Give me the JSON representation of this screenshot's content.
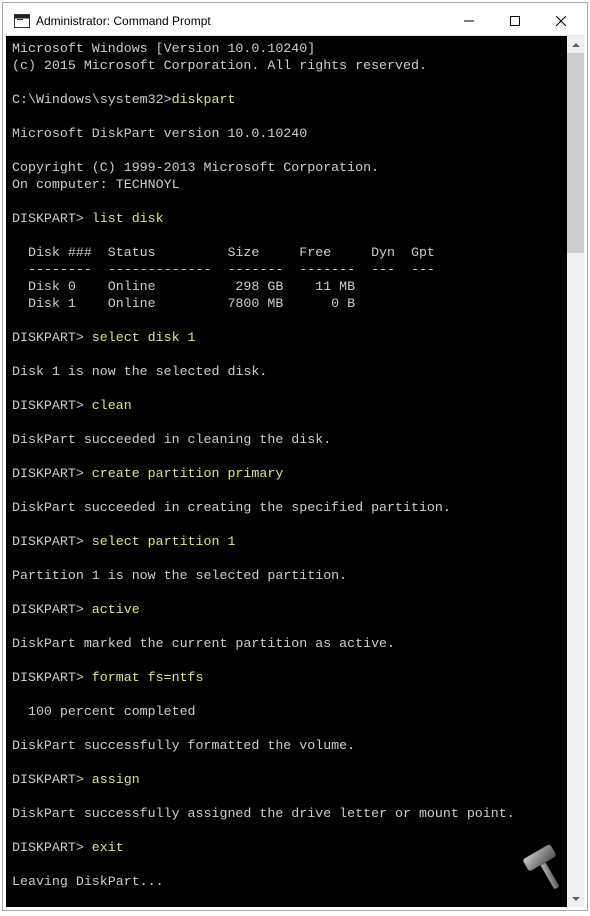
{
  "titlebar": {
    "title": "Administrator: Command Prompt"
  },
  "prompts": {
    "cmd_prompt": "C:\\Windows\\system32>",
    "diskpart_prompt": "DISKPART> "
  },
  "commands": {
    "diskpart": "diskpart",
    "list_disk": "list disk",
    "select_disk1": "select disk 1",
    "clean": "clean",
    "create_partition": "create partition primary",
    "select_partition1": "select partition 1",
    "active": "active",
    "format": "format fs=ntfs",
    "assign": "assign",
    "exit": "exit"
  },
  "output": {
    "header1": "Microsoft Windows [Version 10.0.10240]",
    "header2": "(c) 2015 Microsoft Corporation. All rights reserved.",
    "blank": "",
    "dp_version": "Microsoft DiskPart version 10.0.10240",
    "dp_copyright": "Copyright (C) 1999-2013 Microsoft Corporation.",
    "dp_computer": "On computer: TECHNOYL",
    "disk_header": "  Disk ###  Status         Size     Free     Dyn  Gpt",
    "disk_sep": "  --------  -------------  -------  -------  ---  ---",
    "disk0": "  Disk 0    Online          298 GB    11 MB",
    "disk1": "  Disk 1    Online         7800 MB      0 B",
    "sel_disk1": "Disk 1 is now the selected disk.",
    "clean_ok": "DiskPart succeeded in cleaning the disk.",
    "create_ok": "DiskPart succeeded in creating the specified partition.",
    "sel_part1": "Partition 1 is now the selected partition.",
    "active_ok": "DiskPart marked the current partition as active.",
    "format_progress": "  100 percent completed",
    "format_ok": "DiskPart successfully formatted the volume.",
    "assign_ok": "DiskPart successfully assigned the drive letter or mount point.",
    "leaving": "Leaving DiskPart..."
  },
  "disk_table": {
    "columns": [
      "Disk ###",
      "Status",
      "Size",
      "Free",
      "Dyn",
      "Gpt"
    ],
    "rows": [
      {
        "disk": "Disk 0",
        "status": "Online",
        "size": "298 GB",
        "free": "11 MB",
        "dyn": "",
        "gpt": ""
      },
      {
        "disk": "Disk 1",
        "status": "Online",
        "size": "7800 MB",
        "free": "0 B",
        "dyn": "",
        "gpt": ""
      }
    ]
  }
}
